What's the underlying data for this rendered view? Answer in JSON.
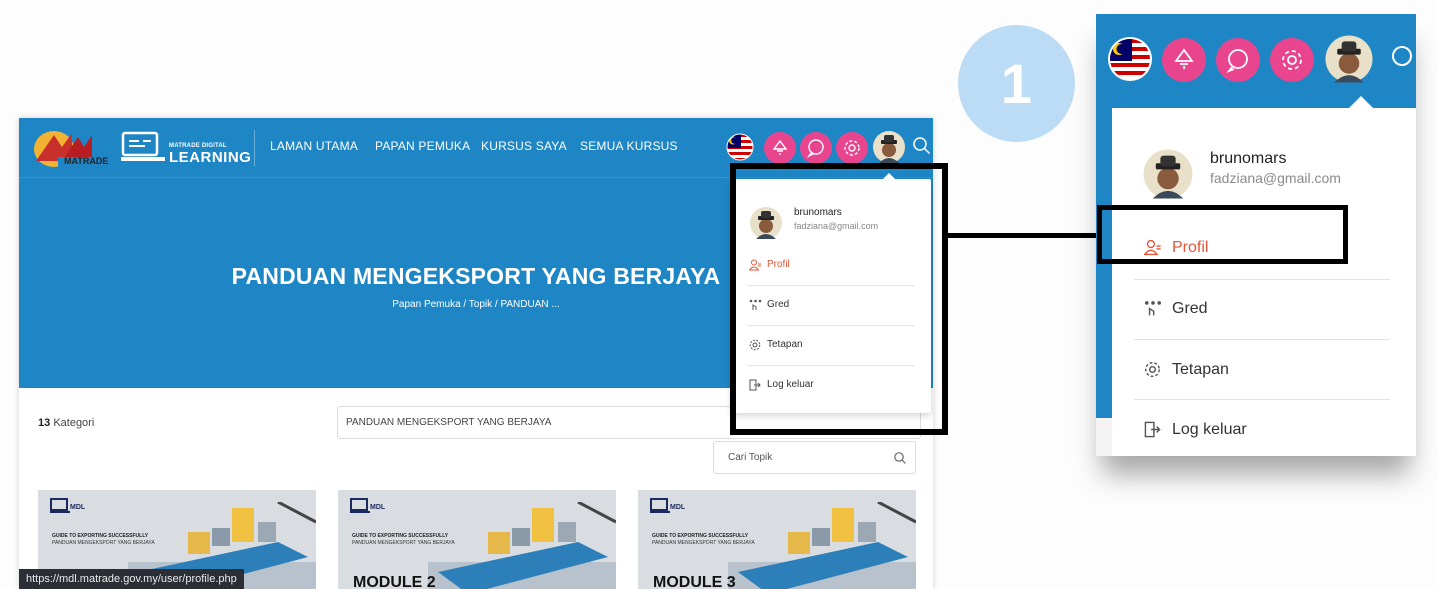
{
  "step": {
    "number": "1"
  },
  "nav": {
    "brand_small": "MATRADE DIGITAL",
    "brand_big": "LEARNING",
    "matrade_text": "MATRADE",
    "items": [
      "LAMAN UTAMA",
      "PAPAN PEMUKA",
      "KURSUS SAYA",
      "SEMUA KURSUS"
    ]
  },
  "hero": {
    "title": "PANDUAN MENGEKSPORT YANG BERJAYA",
    "breadcrumb": "Papan Pemuka  /  Topik  /  PANDUAN ..."
  },
  "filters": {
    "category_count": "13",
    "category_label": "Kategori",
    "selected_topic": "PANDUAN MENGEKSPORT YANG BERJAYA",
    "search_placeholder": "Cari Topik"
  },
  "cards": [
    {
      "brand": "MDL",
      "guide": "GUIDE TO EXPORTING SUCCESSFULLY",
      "guide_ms": "PANDUAN MENGEKSPORT YANG BERJAYA",
      "module": ""
    },
    {
      "brand": "MDL",
      "guide": "GUIDE TO EXPORTING SUCCESSFULLY",
      "guide_ms": "PANDUAN MENGEKSPORT YANG BERJAYA",
      "module": "MODULE 2"
    },
    {
      "brand": "MDL",
      "guide": "GUIDE TO EXPORTING SUCCESSFULLY",
      "guide_ms": "PANDUAN MENGEKSPORT YANG BERJAYA",
      "module": "MODULE 3"
    }
  ],
  "status_url": "https://mdl.matrade.gov.my/user/profile.php",
  "user": {
    "username": "brunomars",
    "email": "fadziana@gmail.com"
  },
  "menu": {
    "profile": "Profil",
    "grades": "Gred",
    "settings": "Tetapan",
    "logout": "Log keluar"
  },
  "icons": [
    "malaysia-flag-icon",
    "notification-icon",
    "message-icon",
    "settings-gear-icon",
    "avatar",
    "search-icon"
  ],
  "colors": {
    "primary": "#1e86c5",
    "accent_pink": "#e9458f",
    "profile_red": "#e2553a",
    "step_circle": "#bcdcf5"
  }
}
